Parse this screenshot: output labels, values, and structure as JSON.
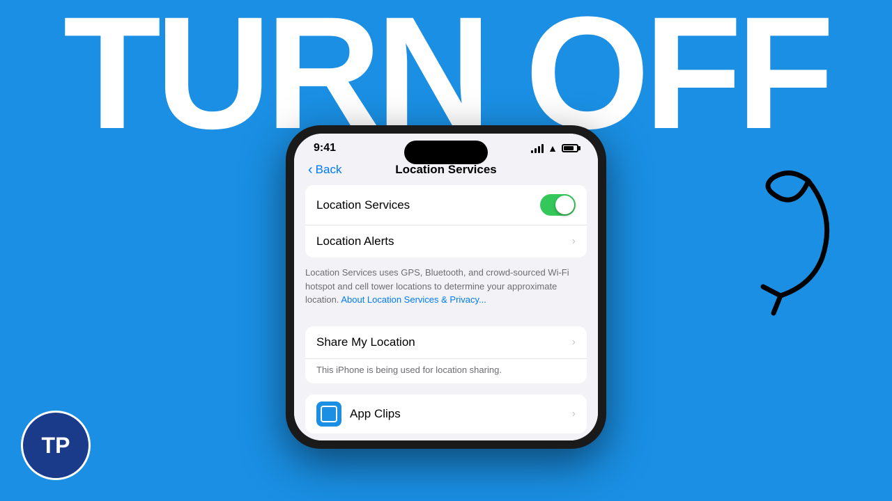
{
  "background": {
    "color": "#1a8fe3"
  },
  "hero": {
    "text": "TURN OFF"
  },
  "logo": {
    "text": "TP"
  },
  "phone": {
    "status_bar": {
      "time": "9:41"
    },
    "nav": {
      "back_label": "Back",
      "title": "Location Services"
    },
    "settings": {
      "location_services_label": "Location Services",
      "location_alerts_label": "Location Alerts",
      "description": "Location Services uses GPS, Bluetooth, and crowd-sourced Wi-Fi hotspot and cell tower locations to determine your approximate location.",
      "description_link": "About Location Services & Privacy...",
      "share_my_location_label": "Share My Location",
      "share_description": "This iPhone is being used for location sharing.",
      "app_clips_label": "App Clips"
    }
  }
}
